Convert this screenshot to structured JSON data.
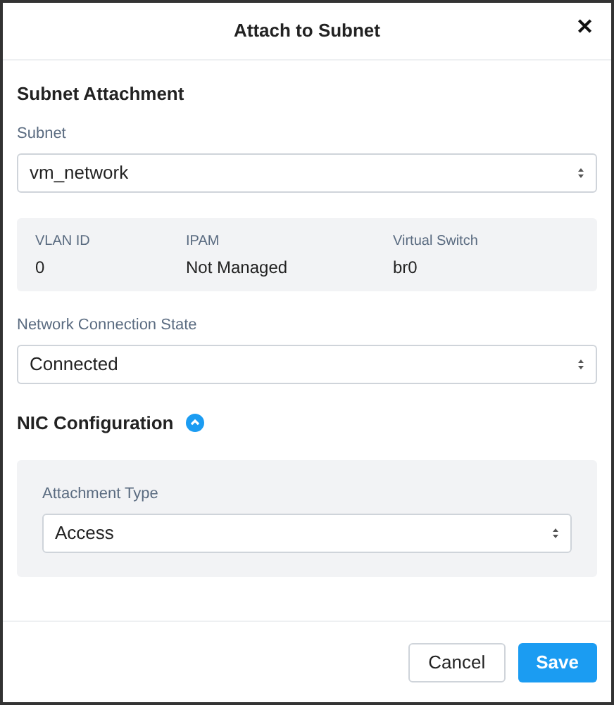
{
  "dialog": {
    "title": "Attach to Subnet",
    "close": "✕"
  },
  "subnet_attachment": {
    "heading": "Subnet Attachment",
    "subnet": {
      "label": "Subnet",
      "value": "vm_network"
    },
    "details": [
      {
        "label": "VLAN ID",
        "value": "0"
      },
      {
        "label": "IPAM",
        "value": "Not Managed"
      },
      {
        "label": "Virtual Switch",
        "value": "br0"
      }
    ],
    "connection_state": {
      "label": "Network Connection State",
      "value": "Connected"
    }
  },
  "nic_configuration": {
    "heading": "NIC Configuration",
    "expanded": true,
    "attachment_type": {
      "label": "Attachment Type",
      "value": "Access"
    }
  },
  "buttons": [
    {
      "label": "Cancel",
      "kind": "secondary"
    },
    {
      "label": "Save",
      "kind": "primary"
    }
  ]
}
